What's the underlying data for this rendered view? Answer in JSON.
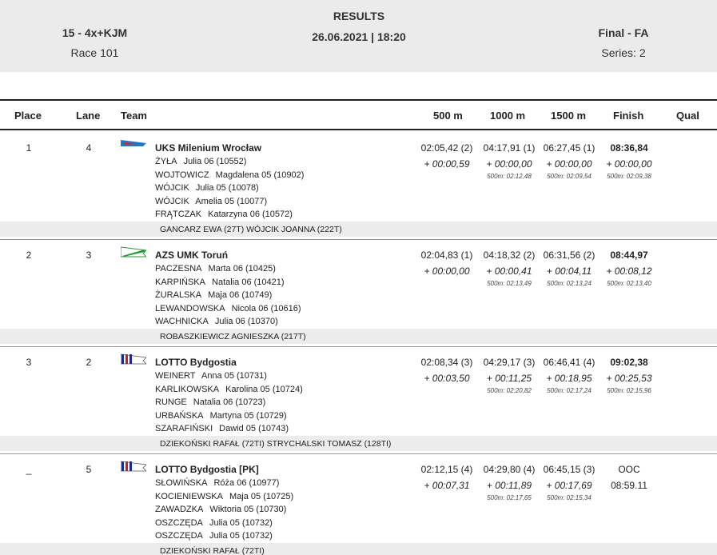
{
  "header": {
    "race_code": "15 - 4x+KJM",
    "race_number": "Race 101",
    "title": "RESULTS",
    "datetime": "26.06.2021 | 18:20",
    "phase": "Final - FA",
    "series": "Series: 2"
  },
  "columns": {
    "place": "Place",
    "lane": "Lane",
    "team": "Team",
    "m500": "500 m",
    "m1000": "1000 m",
    "m1500": "1500 m",
    "finish": "Finish",
    "qual": "Qual"
  },
  "entries": [
    {
      "place": "1",
      "lane": "4",
      "flag": "uks-milenium-flag",
      "team": "UKS Milenium Wrocław",
      "rowers": [
        {
          "last": "ŻYŁA",
          "rest": "Julia 06 (10552)"
        },
        {
          "last": "WOJTOWICZ",
          "rest": "Magdalena 05 (10902)"
        },
        {
          "last": "WÓJCIK",
          "rest": "Julia 05 (10078)"
        },
        {
          "last": "WÓJCIK",
          "rest": "Amelia 05 (10077)"
        },
        {
          "last": "FRĄTCZAK",
          "rest": "Katarzyna 06 (10572)"
        }
      ],
      "coaches": "GANCARZ EWA (27T) WÓJCIK JOANNA (222T)",
      "m500": {
        "time": "02:05,42 (2)",
        "diff": "+ 00:00,59",
        "pace": ""
      },
      "m1000": {
        "time": "04:17,91 (1)",
        "diff": "+ 00:00,00",
        "pace": "500m: 02:12,48"
      },
      "m1500": {
        "time": "06:27,45 (1)",
        "diff": "+ 00:00,00",
        "pace": "500m: 02:09,54"
      },
      "finish": {
        "time": "08:36,84",
        "diff": "+ 00:00,00",
        "pace": "500m: 02:09,38"
      }
    },
    {
      "place": "2",
      "lane": "3",
      "flag": "azs-umk-flag",
      "team": "AZS UMK Toruń",
      "rowers": [
        {
          "last": "PACZESNA",
          "rest": "Marta 06 (10425)"
        },
        {
          "last": "KARPIŃSKA",
          "rest": "Natalia 06 (10421)"
        },
        {
          "last": "ŻURALSKA",
          "rest": "Maja 06 (10749)"
        },
        {
          "last": "LEWANDOWSKA",
          "rest": "Nicola 06 (10616)"
        },
        {
          "last": "WACHNICKA",
          "rest": "Julia 06 (10370)"
        }
      ],
      "coaches": "ROBASZKIEWICZ AGNIESZKA (217T)",
      "m500": {
        "time": "02:04,83 (1)",
        "diff": "+ 00:00,00",
        "pace": ""
      },
      "m1000": {
        "time": "04:18,32 (2)",
        "diff": "+ 00:00,41",
        "pace": "500m: 02:13,49"
      },
      "m1500": {
        "time": "06:31,56 (2)",
        "diff": "+ 00:04,11",
        "pace": "500m: 02:13,24"
      },
      "finish": {
        "time": "08:44,97",
        "diff": "+ 00:08,12",
        "pace": "500m: 02:13,40"
      }
    },
    {
      "place": "3",
      "lane": "2",
      "flag": "lotto-bydgostia-flag",
      "team": "LOTTO Bydgostia",
      "rowers": [
        {
          "last": "WEINERT",
          "rest": "Anna 05 (10731)"
        },
        {
          "last": "KARLIKOWSKA",
          "rest": "Karolina 05 (10724)"
        },
        {
          "last": "RUNGE",
          "rest": "Natalia 06 (10723)"
        },
        {
          "last": "URBAŃSKA",
          "rest": "Martyna 05 (10729)"
        },
        {
          "last": "SZARAFIŃSKI",
          "rest": "Dawid 05 (10743)"
        }
      ],
      "coaches": "DZIEKOŃSKI RAFAŁ (72TI) STRYCHALSKI TOMASZ (128TI)",
      "m500": {
        "time": "02:08,34 (3)",
        "diff": "+ 00:03,50",
        "pace": ""
      },
      "m1000": {
        "time": "04:29,17 (3)",
        "diff": "+ 00:11,25",
        "pace": "500m: 02:20,82"
      },
      "m1500": {
        "time": "06:46,41 (4)",
        "diff": "+ 00:18,95",
        "pace": "500m: 02:17,24"
      },
      "finish": {
        "time": "09:02,38",
        "diff": "+ 00:25,53",
        "pace": "500m: 02:15,96"
      }
    },
    {
      "place": "_",
      "lane": "5",
      "flag": "lotto-bydgostia-flag",
      "team": "LOTTO Bydgostia [PK]",
      "rowers": [
        {
          "last": "SŁOWIŃSKA",
          "rest": "Róża 06 (10977)"
        },
        {
          "last": "KOCIENIEWSKA",
          "rest": "Maja 05 (10725)"
        },
        {
          "last": "ZAWADZKA",
          "rest": "Wiktoria 05 (10730)"
        },
        {
          "last": "OSZCZĘDA",
          "rest": "Julia 05 (10732)"
        },
        {
          "last": "OSZCZĘDA",
          "rest": "Julia 05 (10732)"
        }
      ],
      "coaches": "DZIEKOŃSKI RAFAŁ (72TI)",
      "m500": {
        "time": "02:12,15 (4)",
        "diff": "+ 00:07,31",
        "pace": ""
      },
      "m1000": {
        "time": "04:29,80 (4)",
        "diff": "+ 00:11,89",
        "pace": "500m: 02:17,65"
      },
      "m1500": {
        "time": "06:45,15 (3)",
        "diff": "+ 00:17,69",
        "pace": "500m: 02:15,34"
      },
      "finish": {
        "time": "OOC",
        "diff": "08:59.11",
        "pace": "",
        "plain": true
      }
    }
  ]
}
